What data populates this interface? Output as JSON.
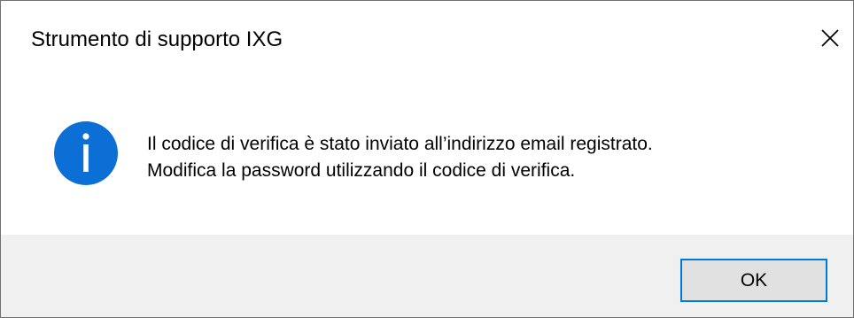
{
  "dialog": {
    "title": "Strumento di supporto IXG",
    "message_lines": [
      "Il codice di verifica è stato inviato all’indirizzo email registrato.",
      "Modifica la password utilizzando il codice di verifica."
    ],
    "icon": "info-icon",
    "close_icon": "close-icon",
    "ok_label": "OK"
  },
  "colors": {
    "info_icon": "#0b6fd6",
    "ok_border": "#0078d7",
    "ok_background": "#e1e1e1",
    "footer_background": "#f0f0f0"
  }
}
